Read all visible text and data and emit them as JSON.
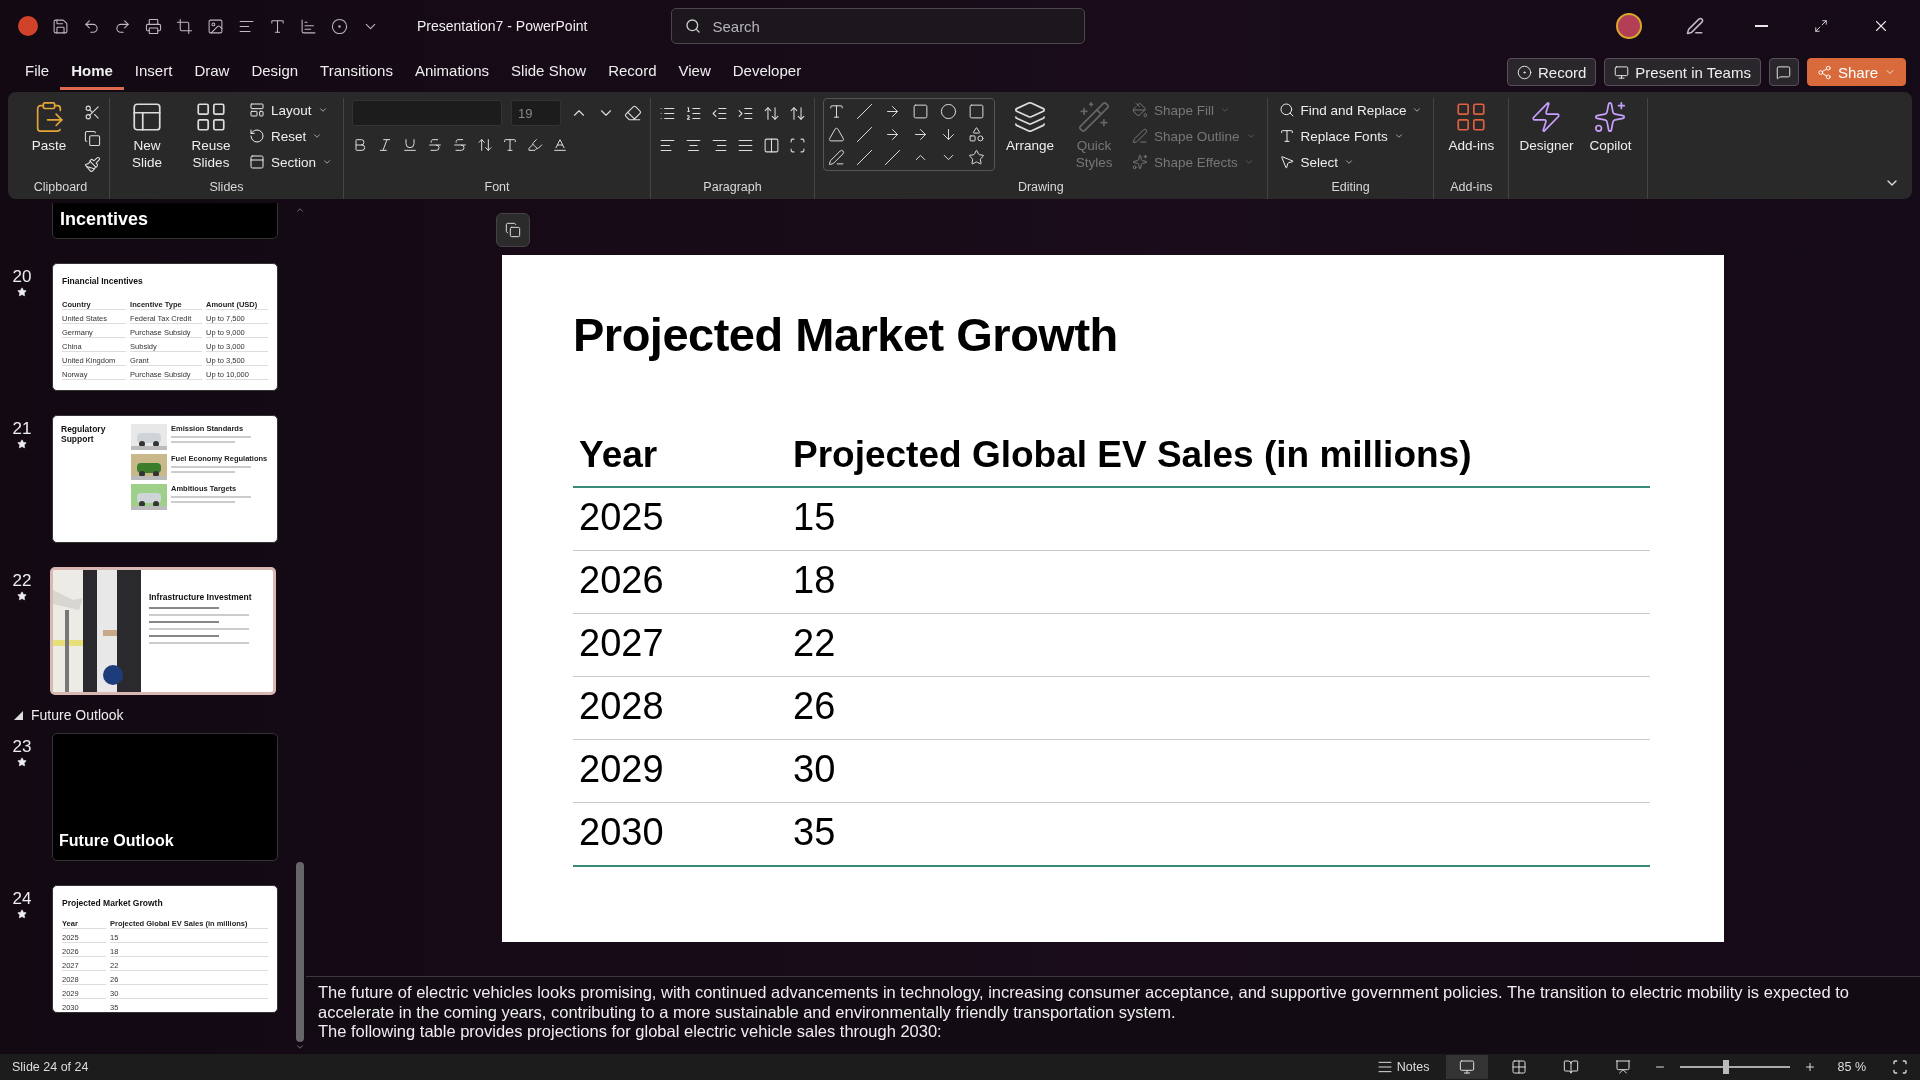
{
  "title_bar": {
    "title": "Presentation7  -  PowerPoint",
    "search": {
      "placeholder": "Search"
    }
  },
  "menu_tabs": [
    {
      "label": "File",
      "selected": false
    },
    {
      "label": "Home",
      "selected": true
    },
    {
      "label": "Insert",
      "selected": false
    },
    {
      "label": "Draw",
      "selected": false
    },
    {
      "label": "Design",
      "selected": false
    },
    {
      "label": "Transitions",
      "selected": false
    },
    {
      "label": "Animations",
      "selected": false
    },
    {
      "label": "Slide Show",
      "selected": false
    },
    {
      "label": "Record",
      "selected": false
    },
    {
      "label": "View",
      "selected": false
    },
    {
      "label": "Developer",
      "selected": false
    }
  ],
  "tab_actions": [
    {
      "label": "Record",
      "kind": "record"
    },
    {
      "label": "Present in Teams",
      "kind": "teams"
    },
    {
      "label": "Share",
      "kind": "share"
    }
  ],
  "ribbon": [
    {
      "kind": "clipboard",
      "title": "Clipboard",
      "buttons": [
        {
          "label": "Paste",
          "kind": "large",
          "disabled": false
        }
      ]
    },
    {
      "kind": "slides",
      "title": "Slides",
      "buttons": [
        {
          "label": "New Slide",
          "kind": "large",
          "disabled": false
        },
        {
          "label": "Reuse Slides",
          "kind": "large",
          "disabled": false
        },
        {
          "label": "Layout",
          "kind": "small",
          "disabled": false
        },
        {
          "label": "Reset",
          "kind": "small",
          "disabled": false
        },
        {
          "label": "Section",
          "kind": "small",
          "disabled": false
        }
      ]
    },
    {
      "kind": "font",
      "title": "Font",
      "font_size": "19"
    },
    {
      "kind": "paragraph",
      "title": "Paragraph"
    },
    {
      "kind": "drawing",
      "title": "Drawing",
      "buttons": [
        {
          "label": "Arrange",
          "kind": "large",
          "disabled": false
        },
        {
          "label": "Quick Styles",
          "kind": "large",
          "disabled": true
        },
        {
          "label": "Shape Fill",
          "kind": "small",
          "disabled": true
        },
        {
          "label": "Shape Outline",
          "kind": "small",
          "disabled": true
        },
        {
          "label": "Shape Effects",
          "kind": "small",
          "disabled": true
        }
      ]
    },
    {
      "kind": "editing",
      "title": "Editing",
      "buttons": [
        {
          "label": "Find and Replace",
          "kind": "small",
          "disabled": false
        },
        {
          "label": "Replace Fonts",
          "kind": "small",
          "disabled": false
        },
        {
          "label": "Select",
          "kind": "small",
          "disabled": false
        }
      ]
    },
    {
      "kind": "addins",
      "title": "Add-ins",
      "buttons": [
        {
          "label": "Add-ins",
          "kind": "large",
          "disabled": false
        }
      ]
    },
    {
      "kind": "ai",
      "buttons": [
        {
          "label": "Designer",
          "kind": "large",
          "disabled": false
        },
        {
          "label": "Copilot",
          "kind": "large",
          "disabled": false
        }
      ]
    }
  ],
  "slides_panel": [
    {
      "kind": "partial",
      "title": "Incentives"
    },
    {
      "kind": "table",
      "number": "20",
      "selected": false,
      "title": "Financial Incentives",
      "columns": [
        "Country",
        "Incentive Type",
        "Amount (USD)"
      ],
      "rows": [
        [
          "United States",
          "Federal Tax Credit",
          "Up to 7,500"
        ],
        [
          "Germany",
          "Purchase Subsidy",
          "Up to 9,000"
        ],
        [
          "China",
          "Subsidy",
          "Up to 3,000"
        ],
        [
          "United Kingdom",
          "Grant",
          "Up to 3,500"
        ],
        [
          "Norway",
          "Purchase Subsidy",
          "Up to 10,000"
        ]
      ]
    },
    {
      "kind": "regulatory",
      "number": "21",
      "selected": false,
      "title": "Regulatory Support",
      "items": [
        "Emission Standards",
        "Fuel Economy Regulations",
        "Ambitious Targets"
      ]
    },
    {
      "kind": "infrastructure",
      "number": "22",
      "selected": true,
      "title": "Infrastructure Investment"
    },
    {
      "kind": "section",
      "label": "Future Outlook",
      "expanded": true
    },
    {
      "kind": "section-title",
      "number": "23",
      "selected": false,
      "title": "Future Outlook"
    },
    {
      "kind": "table",
      "number": "24",
      "selected": false,
      "title": "Projected Market Growth",
      "columns": [
        "Year",
        "Projected Global EV Sales (in millions)"
      ],
      "rows": [
        [
          "2025",
          "15"
        ],
        [
          "2026",
          "18"
        ],
        [
          "2027",
          "22"
        ],
        [
          "2028",
          "26"
        ],
        [
          "2029",
          "30"
        ],
        [
          "2030",
          "35"
        ]
      ]
    }
  ],
  "slide": {
    "title": "Projected Market Growth",
    "columns": [
      "Year",
      "Projected Global EV Sales (in millions)"
    ],
    "rows": [
      [
        "2025",
        "15"
      ],
      [
        "2026",
        "18"
      ],
      [
        "2027",
        "22"
      ],
      [
        "2028",
        "26"
      ],
      [
        "2029",
        "30"
      ],
      [
        "2030",
        "35"
      ]
    ]
  },
  "notes": [
    "The future of electric vehicles looks promising, with continued advancements in technology, increasing consumer acceptance, and supportive government policies. The transition to electric mobility is expected to accelerate in the coming years, contributing to a more sustainable and environmentally friendly transportation system.",
    "The following table provides projections for global electric vehicle sales through 2030:"
  ],
  "status_bar": {
    "slide_info": "Slide 24 of 24",
    "notes_label": "Notes",
    "views": [
      {
        "selected": true
      },
      {
        "selected": false
      },
      {
        "selected": false
      },
      {
        "selected": false
      }
    ],
    "zoom": {
      "level": 0.42,
      "reading": "85 %"
    }
  }
}
